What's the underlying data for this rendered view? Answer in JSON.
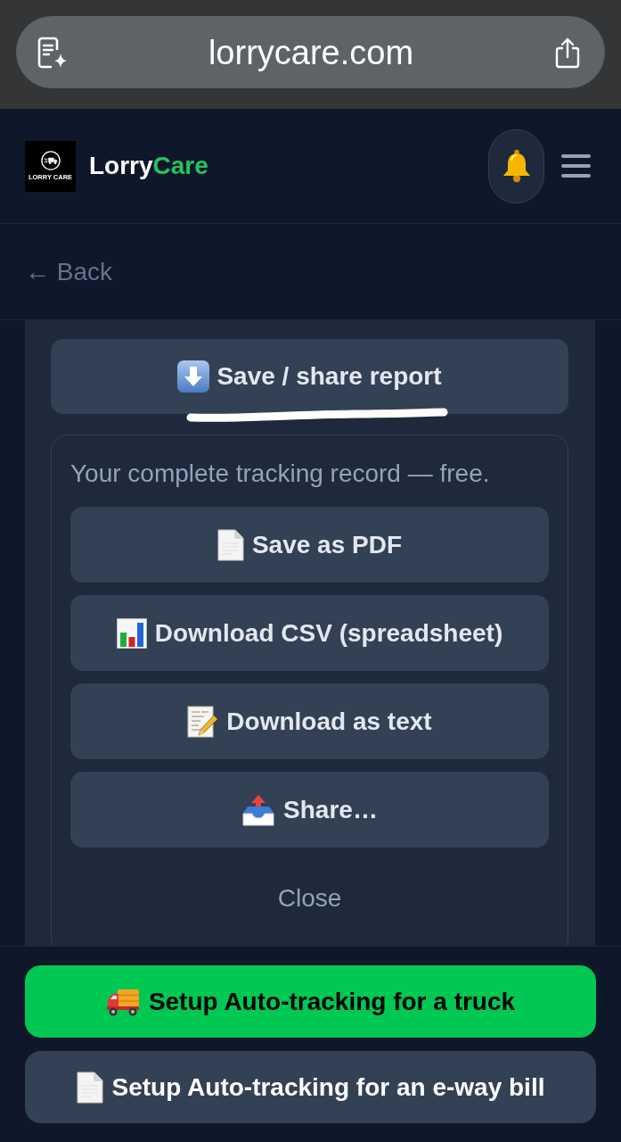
{
  "browser": {
    "url": "lorrycare.com"
  },
  "header": {
    "logo_text": "LORRY CARE",
    "brand_main": "Lorry",
    "brand_accent": "Care"
  },
  "back_link": {
    "label": "← Back"
  },
  "report": {
    "toggle_label": "Save / share report",
    "description": "Your complete tracking record — free.",
    "options": [
      {
        "label": "Save as PDF"
      },
      {
        "label": "Download CSV (spreadsheet)"
      },
      {
        "label": "Download as text"
      },
      {
        "label": "Share…"
      }
    ],
    "close": "Close"
  },
  "bottom_actions": [
    {
      "kind": "primary",
      "label": "Setup Auto-tracking for a truck"
    },
    {
      "kind": "secondary",
      "label": "Setup Auto-tracking for an e-way bill"
    }
  ]
}
